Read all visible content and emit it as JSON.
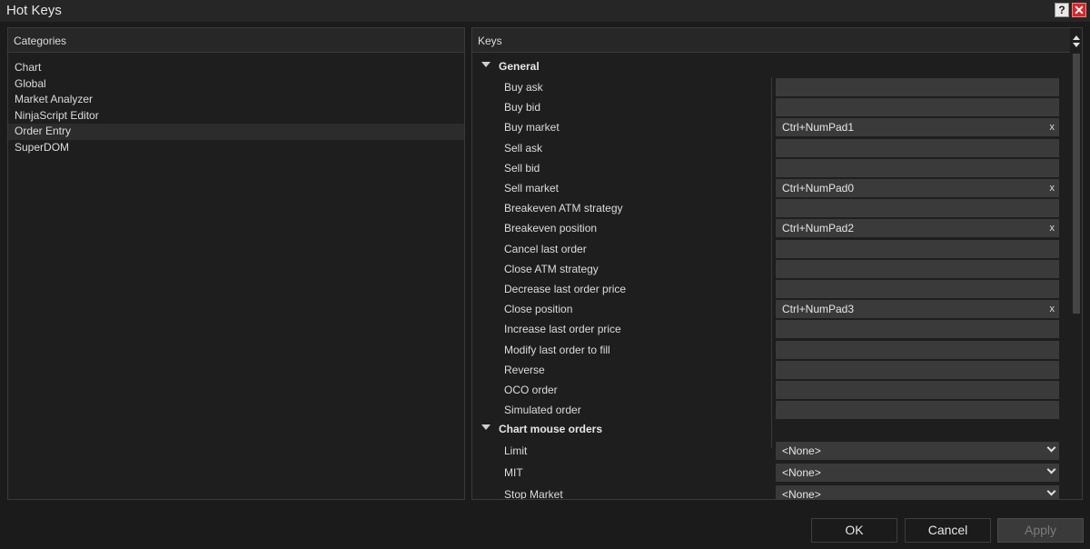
{
  "window": {
    "title": "Hot Keys",
    "help_label": "?",
    "close_label": "✕"
  },
  "categories": {
    "header": "Categories",
    "items": [
      "Chart",
      "Global",
      "Market Analyzer",
      "NinjaScript Editor",
      "Order Entry",
      "SuperDOM"
    ],
    "selected": "Order Entry"
  },
  "keys": {
    "header": "Keys",
    "groups": [
      {
        "name": "General",
        "items": [
          {
            "label": "Buy ask",
            "value": ""
          },
          {
            "label": "Buy bid",
            "value": ""
          },
          {
            "label": "Buy market",
            "value": "Ctrl+NumPad1"
          },
          {
            "label": "Sell ask",
            "value": ""
          },
          {
            "label": "Sell bid",
            "value": ""
          },
          {
            "label": "Sell market",
            "value": "Ctrl+NumPad0"
          },
          {
            "label": "Breakeven ATM strategy",
            "value": ""
          },
          {
            "label": "Breakeven position",
            "value": "Ctrl+NumPad2"
          },
          {
            "label": "Cancel last order",
            "value": ""
          },
          {
            "label": "Close ATM strategy",
            "value": ""
          },
          {
            "label": "Decrease last order price",
            "value": ""
          },
          {
            "label": "Close position",
            "value": "Ctrl+NumPad3"
          },
          {
            "label": "Increase last order price",
            "value": ""
          },
          {
            "label": "Modify last order to fill",
            "value": ""
          },
          {
            "label": "Reverse",
            "value": ""
          },
          {
            "label": "OCO order",
            "value": ""
          },
          {
            "label": "Simulated order",
            "value": ""
          }
        ]
      },
      {
        "name": "Chart mouse orders",
        "items": [
          {
            "label": "Limit",
            "value": "<None>"
          },
          {
            "label": "MIT",
            "value": "<None>"
          },
          {
            "label": "Stop Market",
            "value": "<None>"
          }
        ]
      }
    ],
    "clear_symbol": "x"
  },
  "buttons": {
    "ok": "OK",
    "cancel": "Cancel",
    "apply": "Apply"
  }
}
